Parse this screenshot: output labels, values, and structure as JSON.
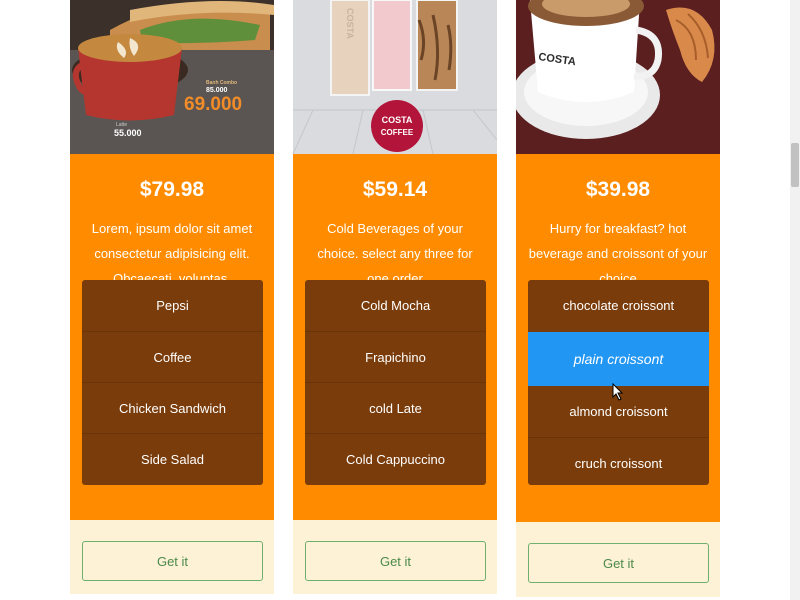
{
  "cards": [
    {
      "price": "$79.98",
      "description": "Lorem, ipsum dolor sit amet consectetur adipisicing elit. Obcaecati, voluptas.",
      "options": [
        "Pepsi",
        "Coffee",
        "Chicken Sandwich",
        "Side Salad"
      ],
      "button_label": "Get it",
      "image_text": {
        "combo_label": "Banh Combo",
        "combo_old_price": "85.000",
        "combo_price": "69.000",
        "latte_label": "Latte",
        "latte_price": "55.000"
      }
    },
    {
      "price": "$59.14",
      "description": "Cold Beverages of your choice. select any three for one order",
      "options": [
        "Cold Mocha",
        "Frapichino",
        "cold Late",
        "Cold Cappuccino"
      ],
      "button_label": "Get it",
      "image_text": {
        "cup_brand": "COSTA",
        "logo_line1": "COSTA",
        "logo_line2": "COFFEE"
      }
    },
    {
      "price": "$39.98",
      "description": "Hurry for breakfast? hot beverage and croissont of your choice",
      "options": [
        "chocolate croissont",
        "plain croissont",
        "almond croissont",
        "cruch croissont"
      ],
      "selected_option": "plain croissont",
      "button_label": "Get it",
      "image_text": {
        "cup_brand": "COSTA"
      }
    }
  ],
  "colors": {
    "card_body": "#ff8c00",
    "options_bg": "#7a3c0a",
    "selected_bg": "#2196f3",
    "footer_bg": "#fdf1d6",
    "button_border": "#6fb06f"
  }
}
